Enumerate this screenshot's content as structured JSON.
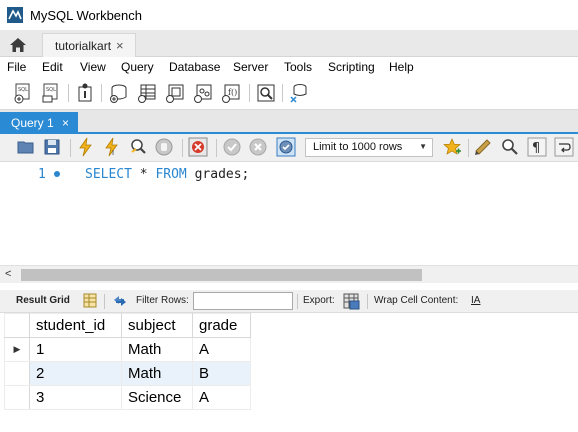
{
  "window": {
    "title": "MySQL Workbench"
  },
  "connection_tab": {
    "label": "tutorialkart",
    "close": "×"
  },
  "menu": [
    "File",
    "Edit",
    "View",
    "Query",
    "Database",
    "Server",
    "Tools",
    "Scripting",
    "Help"
  ],
  "query_tab": {
    "label": "Query 1",
    "close": "×"
  },
  "sql_toolbar": {
    "limit_label": "Limit to 1000 rows"
  },
  "editor": {
    "line_number": "1",
    "kw_select": "SELECT",
    "star": "*",
    "kw_from": "FROM",
    "table_text": "grades;"
  },
  "result_toolbar": {
    "result_grid": "Result Grid",
    "filter_rows": "Filter Rows:",
    "export": "Export:",
    "wrap": "Wrap Cell Content:",
    "wrap_icon": "IA"
  },
  "grid": {
    "columns": [
      "student_id",
      "subject",
      "grade"
    ],
    "rows": [
      [
        "1",
        "Math",
        "A"
      ],
      [
        "2",
        "Math",
        "B"
      ],
      [
        "3",
        "Science",
        "A"
      ]
    ],
    "current_row_marker": "▶"
  },
  "colors": {
    "accent": "#2a8ad4",
    "keyword": "#2a86cf",
    "alt_row": "#e9f1fb"
  }
}
